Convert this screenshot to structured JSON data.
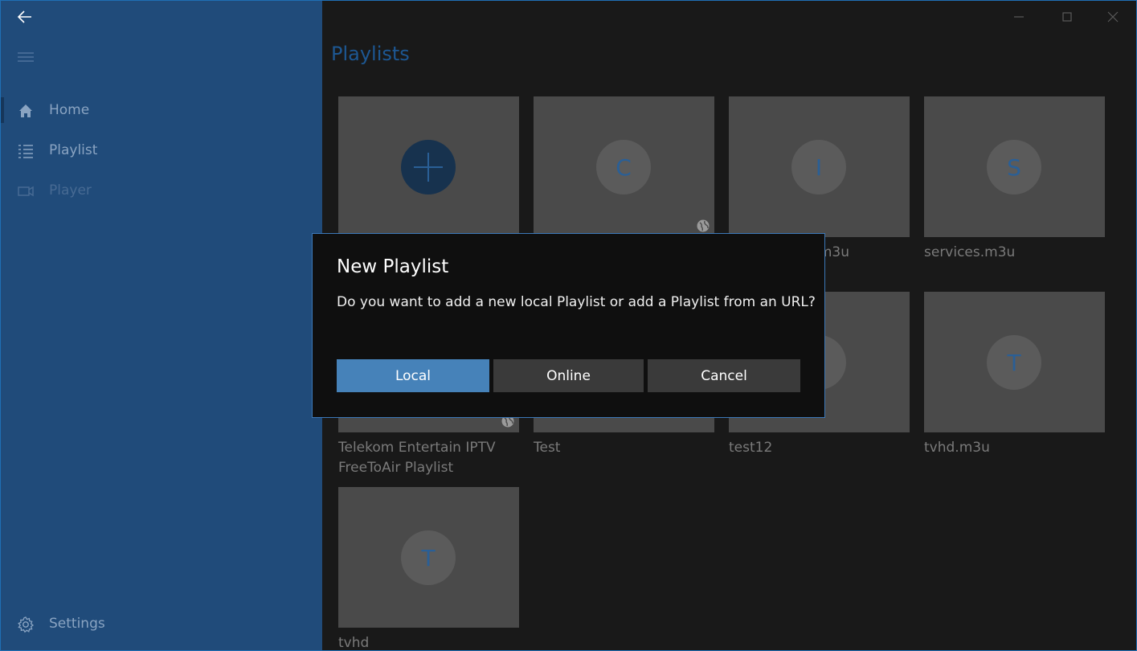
{
  "sidebar": {
    "items": [
      {
        "label": "Home",
        "icon": "home-icon"
      },
      {
        "label": "Playlist",
        "icon": "list-icon"
      },
      {
        "label": "Player",
        "icon": "video-camera-icon"
      }
    ],
    "settings": {
      "label": "Settings",
      "icon": "gear-icon"
    }
  },
  "main": {
    "title": "Playlists",
    "tiles": [
      {
        "initial": "",
        "label": "",
        "online": false,
        "add": true
      },
      {
        "initial": "C",
        "label": "",
        "online": true
      },
      {
        "initial": "I",
        "label": "m3u",
        "online": false
      },
      {
        "initial": "S",
        "label": "services.m3u",
        "online": false
      },
      {
        "initial": "",
        "label": "Telekom Entertain IPTV FreeToAir Playlist",
        "online": true
      },
      {
        "initial": "",
        "label": "Test",
        "online": false
      },
      {
        "initial": "",
        "label": "test12",
        "online": false
      },
      {
        "initial": "T",
        "label": "tvhd.m3u",
        "online": false
      },
      {
        "initial": "T",
        "label": "tvhd",
        "online": false
      }
    ]
  },
  "dialog": {
    "title": "New Playlist",
    "message": "Do you want to add a new local Playlist or add a Playlist from an URL?",
    "buttons": {
      "local": "Local",
      "online": "Online",
      "cancel": "Cancel"
    }
  },
  "colors": {
    "sidebar_bg": "#204b7a",
    "accent": "#4682b9",
    "main_bg": "#191919",
    "tile_bg": "#4a4a4a"
  }
}
